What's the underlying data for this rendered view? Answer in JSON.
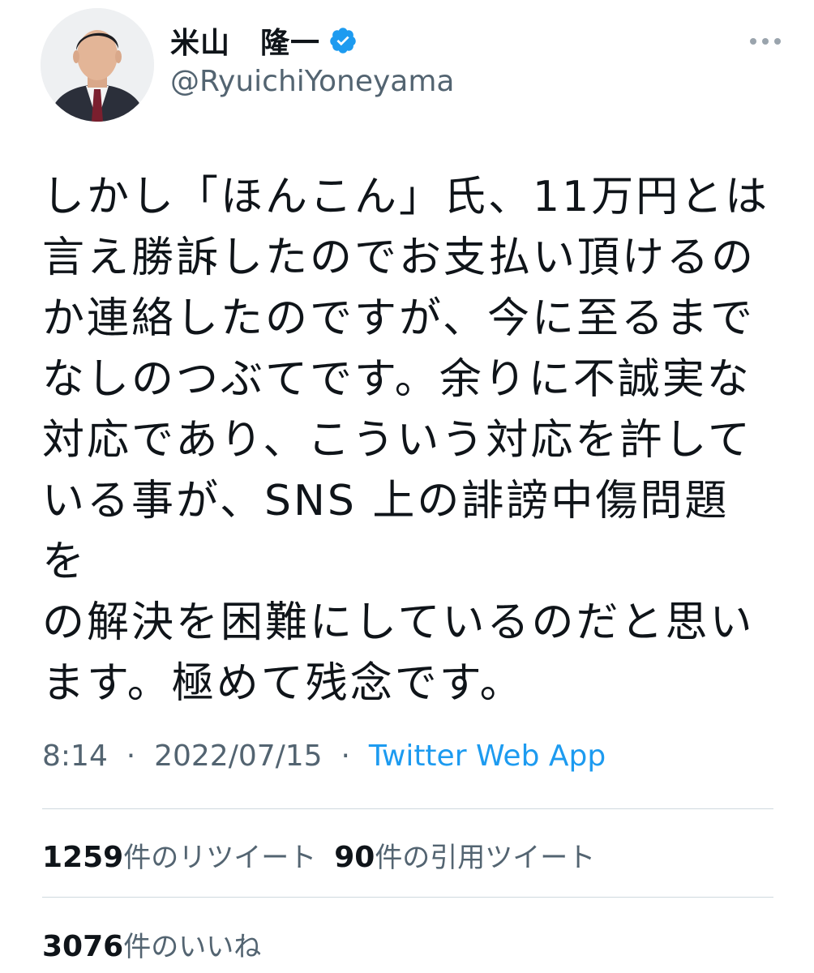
{
  "author": {
    "display_name": "米山　隆一",
    "handle": "@RyuichiYoneyama",
    "verified_icon": "verified-badge-icon",
    "verified_color": "#1d9bf0"
  },
  "menu_icon": "more-horizontal-icon",
  "tweet": {
    "text": "しかし「ほんこん」氏、11万円とは\n言え勝訴したのでお支払い頂けるの\nか連絡したのですが、今に至るまで\nなしのつぶてです。余りに不誠実な\n対応であり、こういう対応を許して\nいる事が、SNS 上の誹謗中傷問題を\nの解決を困難にしているのだと思い\nます。極めて残念です。",
    "time": "8:14",
    "date": "2022/07/15",
    "separator": "·",
    "source": "Twitter Web App"
  },
  "stats": {
    "retweets_count": "1259",
    "retweets_label": "件のリツイート",
    "quotes_count": "90",
    "quotes_label": "件の引用ツイート",
    "likes_count": "3076",
    "likes_label": "件のいいね"
  },
  "colors": {
    "text_primary": "#0f1419",
    "text_secondary": "#536471",
    "link": "#1d9bf0",
    "divider": "#cfd9de"
  }
}
